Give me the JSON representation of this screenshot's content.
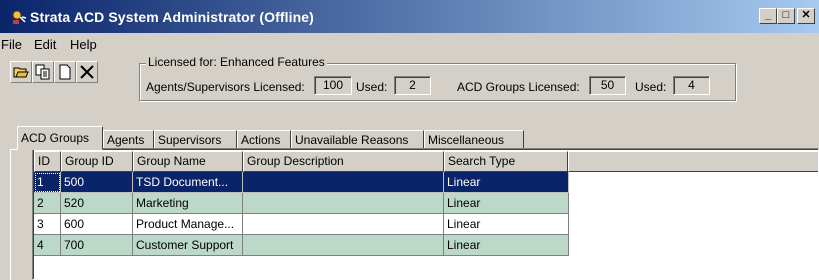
{
  "window": {
    "title": "Strata ACD System Administrator (Offline)",
    "minimize_label": "_",
    "maximize_label": "□",
    "close_label": "✕"
  },
  "menu": [
    "File",
    "Edit",
    "Help"
  ],
  "toolbar": {
    "buttons": [
      "open-icon",
      "copy-icon",
      "new-icon",
      "delete-icon"
    ]
  },
  "license": {
    "legend": "Licensed for: Enhanced Features",
    "agents_label": "Agents/Supervisors Licensed:",
    "agents_licensed": "100",
    "agents_used_label": "Used:",
    "agents_used": "2",
    "groups_label": "ACD Groups Licensed:",
    "groups_licensed": "50",
    "groups_used_label": "Used:",
    "groups_used": "4"
  },
  "tabs": [
    "ACD Groups",
    "Agents",
    "Supervisors",
    "Actions",
    "Unavailable Reasons",
    "Miscellaneous"
  ],
  "active_tab": "ACD Groups",
  "table": {
    "columns": [
      "ID",
      "Group ID",
      "Group Name",
      "Group Description",
      "Search Type"
    ],
    "rows": [
      {
        "id": "1",
        "group_id": "500",
        "group_name": "TSD Document...",
        "description": "",
        "search_type": "Linear"
      },
      {
        "id": "2",
        "group_id": "520",
        "group_name": "Marketing",
        "description": "",
        "search_type": "Linear"
      },
      {
        "id": "3",
        "group_id": "600",
        "group_name": "Product Manage...",
        "description": "",
        "search_type": "Linear"
      },
      {
        "id": "4",
        "group_id": "700",
        "group_name": "Customer Support",
        "description": "",
        "search_type": "Linear"
      }
    ]
  },
  "colors": {
    "titlebar_start": "#0a246a",
    "titlebar_end": "#a6caf0",
    "selection": "#0a246a",
    "alt_row": "#bcd8c8",
    "chrome": "#d4d0c8"
  }
}
